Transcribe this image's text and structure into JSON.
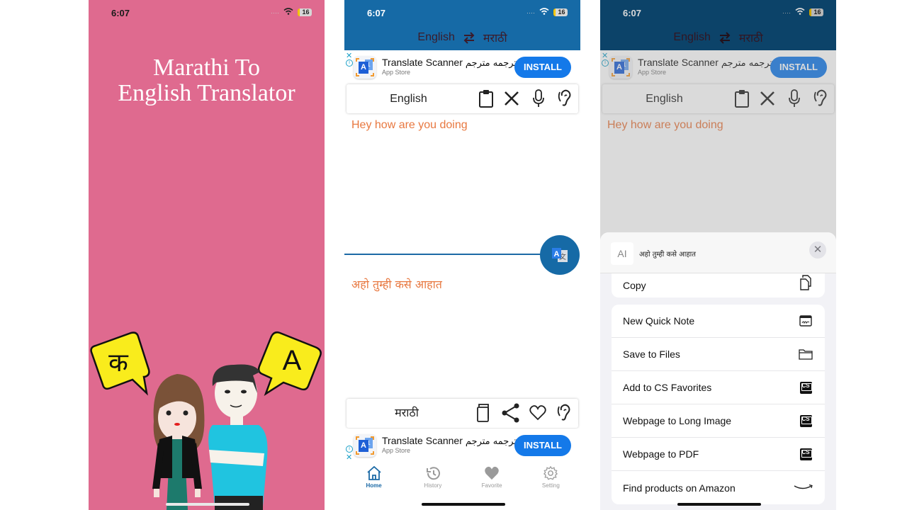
{
  "status_bar": {
    "time": "6:07",
    "battery": "16"
  },
  "splash": {
    "title_line1": "Marathi To",
    "title_line2": "English Translator",
    "bubble_left": "क",
    "bubble_right": "A"
  },
  "translator": {
    "header": {
      "source_lang": "English",
      "target_lang": "मराठी",
      "swap_icon": "swap-arrows-icon"
    },
    "ad": {
      "app_name": "Translate Scanner",
      "app_name_urdu": "ترجمه مترجم",
      "store": "App Store",
      "install_label": "INSTALL",
      "close": "✕",
      "info": "i"
    },
    "input_toolbar": {
      "label": "English",
      "icons": [
        "clipboard-icon",
        "close-icon",
        "microphone-icon",
        "ear-icon"
      ]
    },
    "input_text": "Hey how are you doing",
    "output_toolbar": {
      "label": "मराठी",
      "icons": [
        "copy-icon",
        "share-icon",
        "heart-icon",
        "ear-icon"
      ]
    },
    "output_text": "अहो तुम्ही कसे आहात",
    "tabs": [
      {
        "label": "Home",
        "icon": "home-icon",
        "active": true
      },
      {
        "label": "History",
        "icon": "history-icon",
        "active": false
      },
      {
        "label": "Favorite",
        "icon": "heart-icon",
        "active": false
      },
      {
        "label": "Setting",
        "icon": "gear-icon",
        "active": false
      }
    ]
  },
  "share_sheet": {
    "preview_text": "अहो तुम्ही कसे आहात",
    "preview_icon": "AI",
    "close": "✕",
    "copy_label": "Copy",
    "actions": [
      {
        "label": "New Quick Note",
        "icon": "quick-note-icon"
      },
      {
        "label": "Save to Files",
        "icon": "folder-icon"
      },
      {
        "label": "Add to CS Favorites",
        "icon": "cs-icon"
      },
      {
        "label": "Webpage to Long Image",
        "icon": "cs-icon"
      },
      {
        "label": "Webpage to PDF",
        "icon": "cs-icon"
      },
      {
        "label": "Find products on Amazon",
        "icon": "amazon-icon"
      }
    ],
    "cs_badge": "CS"
  },
  "colors": {
    "splash_bg": "#df6a8f",
    "header_blue": "#166aa6",
    "accent_orange": "#e87840",
    "install_blue": "#1479e9"
  }
}
